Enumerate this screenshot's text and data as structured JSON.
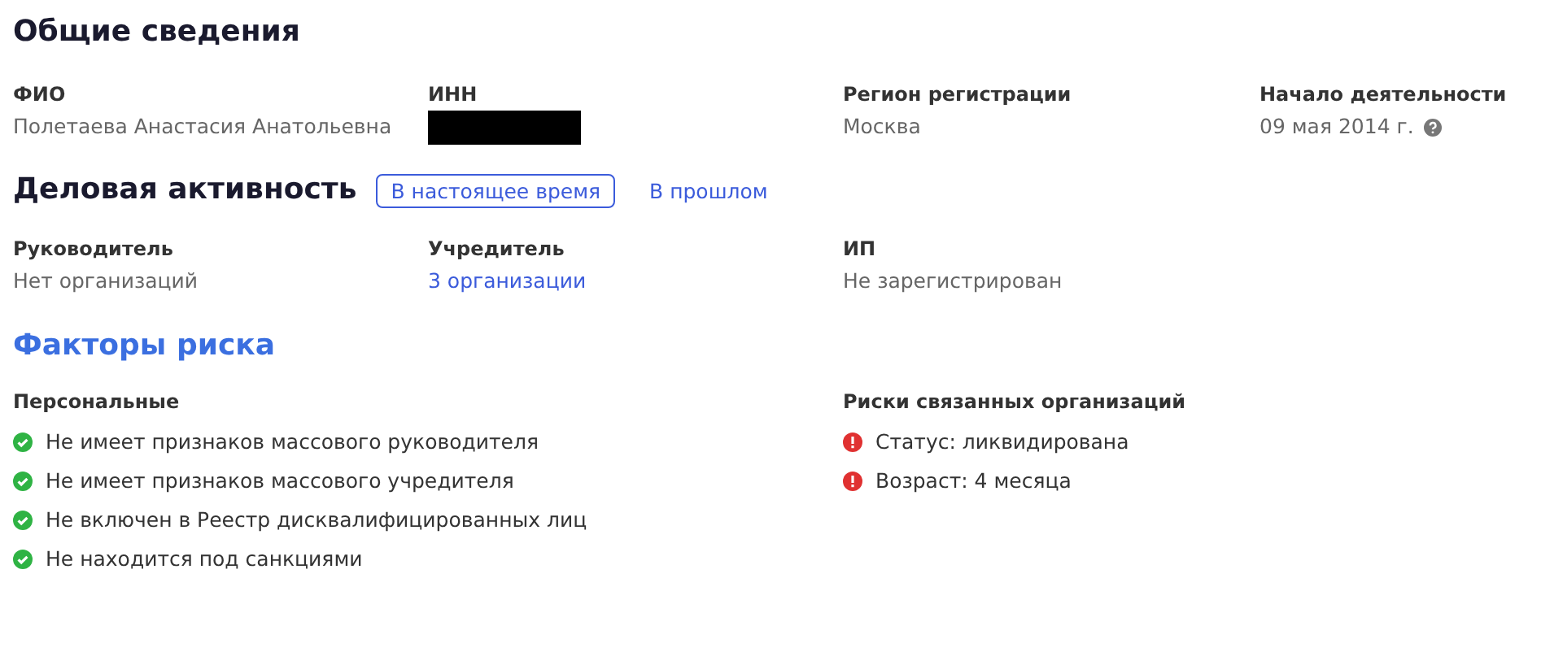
{
  "general": {
    "title": "Общие сведения",
    "fields": [
      {
        "label": "ФИО",
        "kind": "text",
        "value": "Полетаева Анастасия Анатольевна"
      },
      {
        "label": "ИНН",
        "kind": "redacted"
      },
      {
        "label": "Регион регистрации",
        "kind": "text",
        "value": "Москва"
      },
      {
        "label": "Начало деятельности",
        "kind": "text",
        "value": "09 мая 2014 г.",
        "help": true
      }
    ]
  },
  "activity": {
    "title": "Деловая активность",
    "tabs": [
      {
        "label": "В настоящее время",
        "selected": true
      },
      {
        "label": "В прошлом",
        "selected": false
      }
    ],
    "fields": [
      {
        "label": "Руководитель",
        "kind": "text",
        "value": "Нет организаций"
      },
      {
        "label": "Учредитель",
        "kind": "link",
        "value": "3 организации"
      },
      {
        "label": "ИП",
        "kind": "text",
        "value": "Не зарегистрирован"
      }
    ]
  },
  "risks": {
    "title": "Факторы риска",
    "groups": [
      {
        "title": "Персональные",
        "items": [
          {
            "kind": "ok",
            "text": "Не имеет признаков массового руководителя"
          },
          {
            "kind": "ok",
            "text": "Не имеет признаков массового учредителя"
          },
          {
            "kind": "ok",
            "text": "Не включен в Реестр дисквалифицированных лиц"
          },
          {
            "kind": "ok",
            "text": "Не находится под санкциями"
          }
        ]
      },
      {
        "title": "Риски связанных организаций",
        "items": [
          {
            "kind": "warning",
            "text": "Статус: ликвидирована"
          },
          {
            "kind": "warning",
            "text": "Возраст: 4 месяца"
          }
        ]
      }
    ]
  }
}
